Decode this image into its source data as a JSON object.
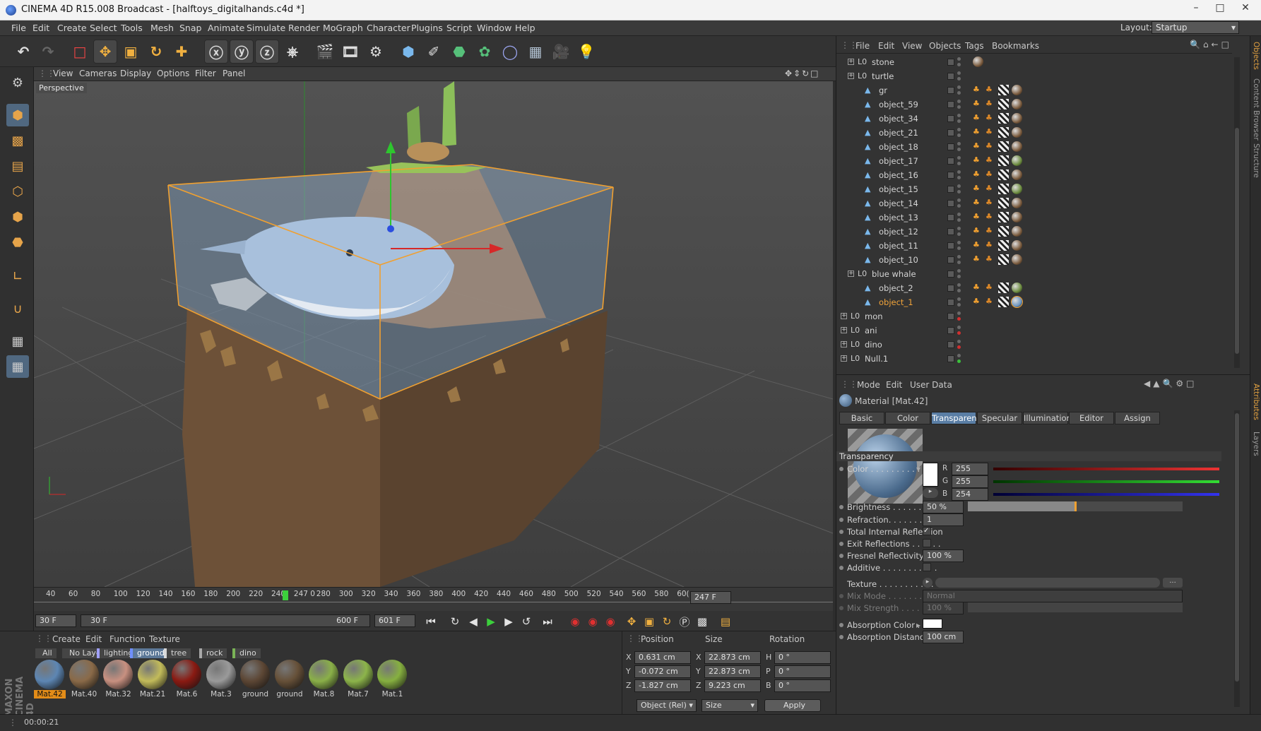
{
  "window": {
    "title": "CINEMA 4D R15.008 Broadcast - [halftoys_digitalhands.c4d *]"
  },
  "menu": [
    "File",
    "Edit",
    "Create",
    "Select",
    "Tools",
    "Mesh",
    "Snap",
    "Animate",
    "Simulate",
    "Render",
    "MoGraph",
    "Character",
    "Plugins",
    "Script",
    "Window",
    "Help"
  ],
  "layout": {
    "label": "Layout:",
    "value": "Startup"
  },
  "viewport": {
    "menu": [
      "View",
      "Cameras",
      "Display",
      "Options",
      "Filter",
      "Panel"
    ],
    "label": "Perspective"
  },
  "timeline": {
    "ticks": [
      "40",
      "60",
      "80",
      "100",
      "120",
      "140",
      "160",
      "180",
      "200",
      "220",
      "240",
      "247 0",
      "280",
      "300",
      "320",
      "340",
      "360",
      "380",
      "400",
      "420",
      "440",
      "460",
      "480",
      "500",
      "520",
      "540",
      "560",
      "580",
      "60("
    ],
    "current_frame": "247 F"
  },
  "transport": {
    "start": "30 F",
    "range_start": "30 F",
    "range_end": "600 F",
    "end": "601 F"
  },
  "material_manager": {
    "menu": [
      "Create",
      "Edit",
      "Function",
      "Texture"
    ],
    "filters": [
      "All",
      "No Layer",
      "lighting",
      "ground",
      "tree",
      "rock",
      "dino"
    ],
    "filter_colors": [
      "",
      "",
      "#a0a0ff",
      "#6f8fff",
      "#d8d8d8",
      "#a8a8a8",
      "#7ab356"
    ],
    "materials": [
      {
        "name": "Mat.42",
        "color": "#5d86b3",
        "selected": true
      },
      {
        "name": "Mat.40",
        "color": "#8a6a48"
      },
      {
        "name": "Mat.32",
        "color": "#c89080"
      },
      {
        "name": "Mat.21",
        "color": "#c2bb5a"
      },
      {
        "name": "Mat.6",
        "color": "#8a1a12"
      },
      {
        "name": "Mat.3",
        "color": "#9a9a9a"
      },
      {
        "name": "ground",
        "color": "#5c4634"
      },
      {
        "name": "ground",
        "color": "#665038"
      },
      {
        "name": "Mat.8",
        "color": "#8ab048"
      },
      {
        "name": "Mat.7",
        "color": "#8cb44a"
      },
      {
        "name": "Mat.1",
        "color": "#86b040"
      }
    ]
  },
  "coords": {
    "headers": [
      "Position",
      "Size",
      "Rotation"
    ],
    "rows": [
      {
        "axis": "X",
        "pos": "0.631 cm",
        "saxis": "X",
        "size": "22.873 cm",
        "raxis": "H",
        "rot": "0 °"
      },
      {
        "axis": "Y",
        "pos": "-0.072 cm",
        "saxis": "Y",
        "size": "22.873 cm",
        "raxis": "P",
        "rot": "0 °"
      },
      {
        "axis": "Z",
        "pos": "-1.827 cm",
        "saxis": "Z",
        "size": "9.223 cm",
        "raxis": "B",
        "rot": "0 °"
      }
    ],
    "mode": "Object (Rel)",
    "size_mode": "Size",
    "apply": "Apply"
  },
  "status": {
    "time": "00:00:21"
  },
  "objects": {
    "menu": [
      "File",
      "Edit",
      "View",
      "Objects",
      "Tags",
      "Bookmarks"
    ],
    "rows": [
      {
        "name": "stone",
        "level": 1,
        "group": true
      },
      {
        "name": "turtle",
        "level": 1,
        "group": true
      },
      {
        "name": "gr",
        "level": 2
      },
      {
        "name": "object_59",
        "level": 2
      },
      {
        "name": "object_34",
        "level": 2
      },
      {
        "name": "object_21",
        "level": 2
      },
      {
        "name": "object_18",
        "level": 2
      },
      {
        "name": "object_17",
        "level": 2
      },
      {
        "name": "object_16",
        "level": 2
      },
      {
        "name": "object_15",
        "level": 2
      },
      {
        "name": "object_14",
        "level": 2
      },
      {
        "name": "object_13",
        "level": 2
      },
      {
        "name": "object_12",
        "level": 2
      },
      {
        "name": "object_11",
        "level": 2
      },
      {
        "name": "object_10",
        "level": 2
      },
      {
        "name": "blue whale",
        "level": 1,
        "group": true
      },
      {
        "name": "object_2",
        "level": 2
      },
      {
        "name": "object_1",
        "level": 2,
        "selected": true
      },
      {
        "name": "mon",
        "level": 0,
        "group": true
      },
      {
        "name": "ani",
        "level": 0,
        "group": true
      },
      {
        "name": "dino",
        "level": 0,
        "group": true
      },
      {
        "name": "Null.1",
        "level": 0,
        "group": true
      }
    ]
  },
  "attributes": {
    "menu": [
      "Mode",
      "Edit",
      "User Data"
    ],
    "material_label": "Material [Mat.42]",
    "tabs": [
      "Basic",
      "Color",
      "Transparency",
      "Specular",
      "Illumination",
      "Editor",
      "Assign"
    ],
    "active_tab": "Transparency",
    "section": "Transparency",
    "color_label": "Color . . . . . . . . . . .",
    "r": "255",
    "g": "255",
    "b": "254",
    "brightness_label": "Brightness . . . . . . . . .",
    "brightness": "50 %",
    "brightness_fraction": 0.5,
    "refraction_label": "Refraction. . . . . . . . .",
    "refraction": "1",
    "tir_label": "Total Internal Reflection",
    "exit_label": "Exit Reflections . . . . . .",
    "fresnel_label": "Fresnel Reflectivity. . . .",
    "fresnel": "100 %",
    "additive_label": "Additive . . . . . . . . . . .",
    "texture_label": "Texture . . . . . . . . . . .",
    "mix_mode_label": "Mix Mode . . . . . . . . . .",
    "mix_mode": "Normal",
    "mix_strength_label": "Mix Strength . . . . . . . .",
    "mix_strength": "100 %",
    "absorption_color_label": "Absorption Color . . .",
    "absorption_distance_label": "Absorption Distance . . .",
    "absorption_distance": "100 cm"
  },
  "side_tabs": [
    "Objects",
    "Content Browser",
    "Structure",
    "Attributes",
    "Layers"
  ]
}
